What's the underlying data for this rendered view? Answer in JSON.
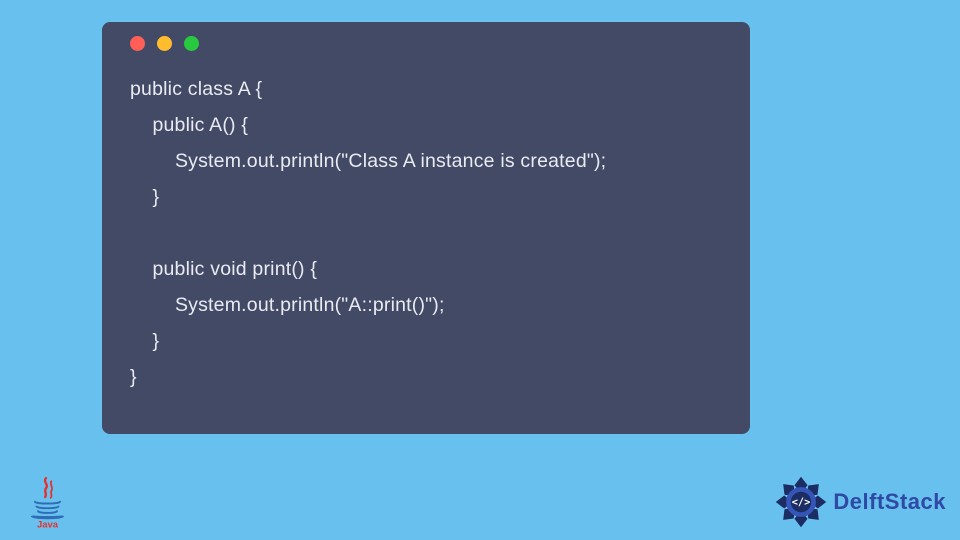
{
  "code": {
    "lines": [
      "public class A {",
      "    public A() {",
      "        System.out.println(\"Class A instance is created\");",
      "    }",
      "",
      "    public void print() {",
      "        System.out.println(\"A::print()\");",
      "    }",
      "}"
    ]
  },
  "window": {
    "dots": [
      "red",
      "yellow",
      "green"
    ]
  },
  "logos": {
    "java_label": "Java",
    "delft_label": "DelftStack"
  },
  "colors": {
    "background": "#68c0ee",
    "window_bg": "#434a66",
    "code_text": "#e9ebf1",
    "delft_blue": "#2f4aa4"
  }
}
